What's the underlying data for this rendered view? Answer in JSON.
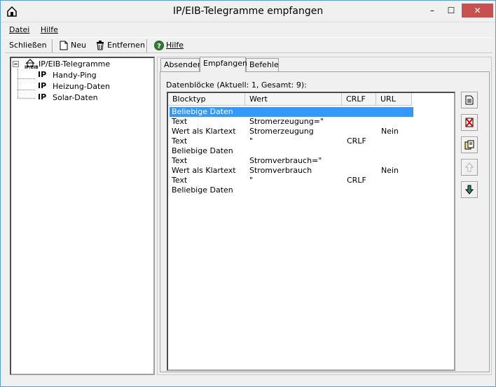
{
  "window": {
    "title": "IP/EIB-Telegramme empfangen"
  },
  "titlebar_buttons": {
    "minimize": "–",
    "maximize": "☐",
    "close": "✕"
  },
  "menu": [
    {
      "label": "Datei"
    },
    {
      "label": "Hilfe"
    }
  ],
  "toolbar": {
    "close_label": "Schließen",
    "new_label": "Neu",
    "remove_label": "Entfernen",
    "help_label": "Hilfe"
  },
  "tree": {
    "root": "IP/EIB-Telegramme",
    "root_icon_text": "IP/EIB",
    "ip_glyph": "IP",
    "items": [
      {
        "label": "Handy-Ping"
      },
      {
        "label": "Heizung-Daten"
      },
      {
        "label": "Solar-Daten"
      }
    ]
  },
  "tabs": [
    {
      "label": "Absender"
    },
    {
      "label": "Empfangen"
    },
    {
      "label": "Befehle"
    }
  ],
  "active_tab": "Empfangen",
  "blocks": {
    "label": "Datenblöcke (Aktuell: 1, Gesamt: 9):",
    "columns": [
      "Blocktyp",
      "Wert",
      "CRLF",
      "URL"
    ],
    "rows": [
      {
        "type": "Beliebige Daten",
        "value": "",
        "crlf": "",
        "url": ""
      },
      {
        "type": "Text",
        "value": "Stromerzeugung=\"",
        "crlf": "",
        "url": ""
      },
      {
        "type": "Wert als Klartext",
        "value": "Stromerzeugung",
        "crlf": "",
        "url": "Nein"
      },
      {
        "type": "Text",
        "value": "\"",
        "crlf": "CRLF",
        "url": ""
      },
      {
        "type": "Beliebige Daten",
        "value": "",
        "crlf": "",
        "url": ""
      },
      {
        "type": "Text",
        "value": "Stromverbrauch=\"",
        "crlf": "",
        "url": ""
      },
      {
        "type": "Wert als Klartext",
        "value": "Stromverbrauch",
        "crlf": "",
        "url": "Nein"
      },
      {
        "type": "Text",
        "value": "\"",
        "crlf": "CRLF",
        "url": ""
      },
      {
        "type": "Beliebige Daten",
        "value": "",
        "crlf": "",
        "url": ""
      }
    ]
  },
  "colors": {
    "selection": "#3399ff",
    "close_button": "#c75050",
    "window_border": "#5a9fd4"
  }
}
